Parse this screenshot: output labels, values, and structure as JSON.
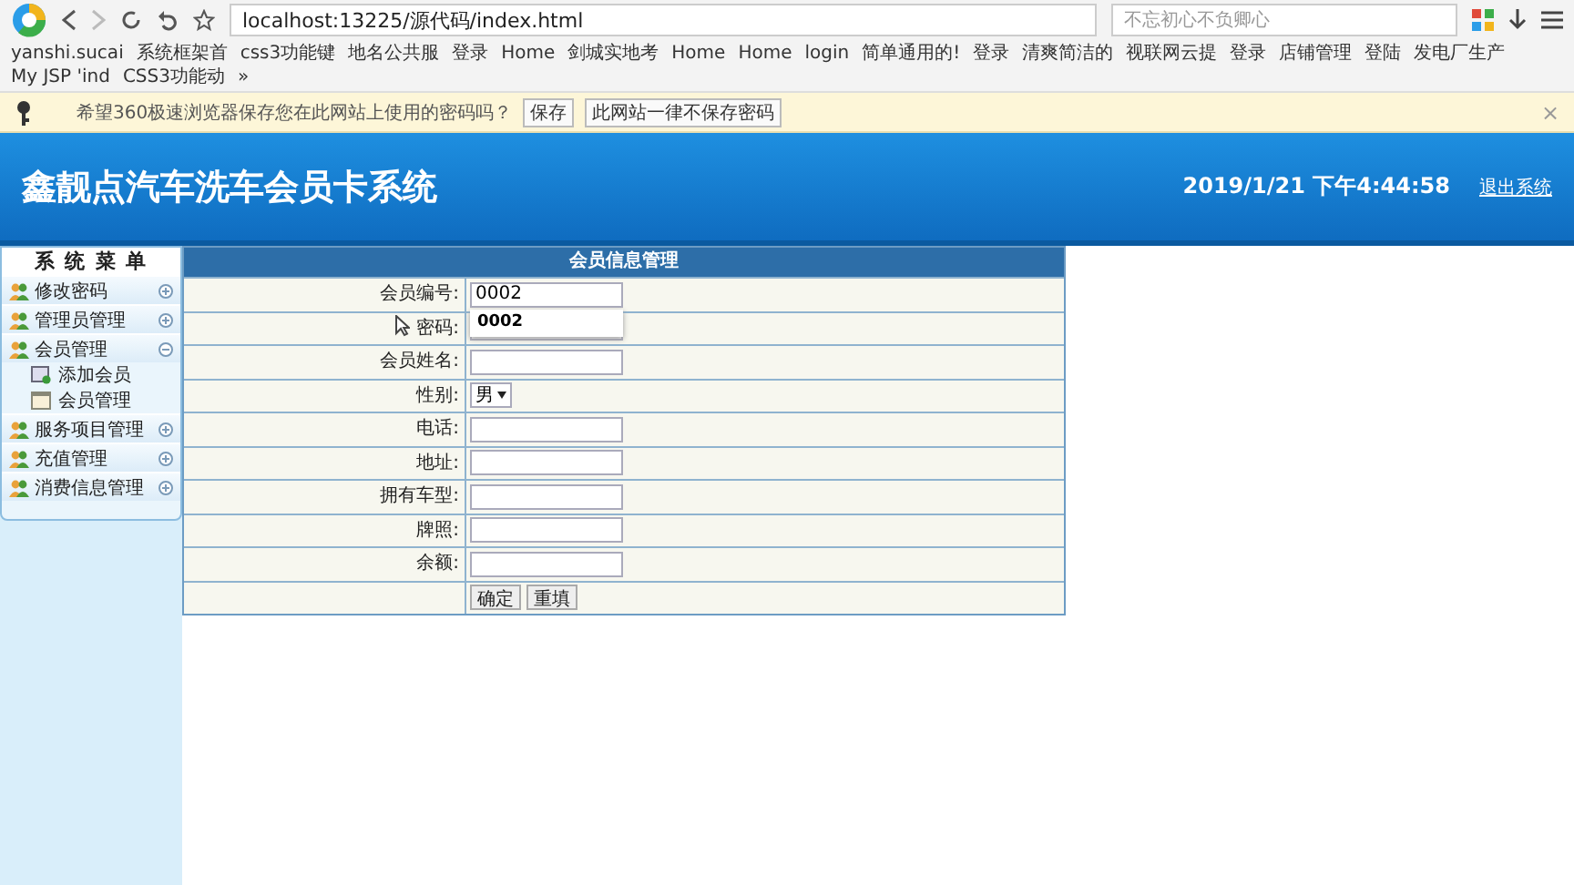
{
  "browser": {
    "address": "localhost:13225/源代码/index.html",
    "search_placeholder": "不忘初心不负卿心",
    "bookmarks": [
      "yanshi.sucai",
      "系统框架首",
      "css3功能键",
      "地名公共服",
      "登录",
      "Home",
      "剑城实地考",
      "Home",
      "Home",
      "login",
      "简单通用的!",
      "登录",
      "清爽简洁的",
      "视联网云提",
      "登录",
      "店铺管理",
      "登陆",
      "发电厂生产",
      "My JSP 'ind",
      "CSS3功能动"
    ],
    "more": "»"
  },
  "password_bar": {
    "message": "希望360极速浏览器保存您在此网站上使用的密码吗？",
    "buttons": [
      "保存",
      "此网站一律不保存密码"
    ],
    "close": "×"
  },
  "header": {
    "title": "鑫靓点汽车洗车会员卡系统",
    "datetime": "2019/1/21 下午4:44:58",
    "logout": "退出系统"
  },
  "sidebar": {
    "title": "系 统 菜 单",
    "items": [
      {
        "label": "修改密码",
        "expanded": false
      },
      {
        "label": "管理员管理",
        "expanded": false
      },
      {
        "label": "会员管理",
        "expanded": true,
        "children": [
          {
            "label": "添加会员",
            "kind": "add"
          },
          {
            "label": "会员管理",
            "kind": "list"
          }
        ]
      },
      {
        "label": "服务项目管理",
        "expanded": false
      },
      {
        "label": "充值管理",
        "expanded": false
      },
      {
        "label": "消费信息管理",
        "expanded": false
      }
    ]
  },
  "form": {
    "title": "会员信息管理",
    "fields": [
      {
        "label": "会员编号:",
        "kind": "input",
        "value": "0002",
        "suggestion": "0002"
      },
      {
        "label": "密码:",
        "kind": "input"
      },
      {
        "label": "会员姓名:",
        "kind": "input"
      },
      {
        "label": "性别:",
        "kind": "select",
        "value": "男"
      },
      {
        "label": "电话:",
        "kind": "input"
      },
      {
        "label": "地址:",
        "kind": "input"
      },
      {
        "label": "拥有车型:",
        "kind": "input"
      },
      {
        "label": "牌照:",
        "kind": "input"
      },
      {
        "label": "余额:",
        "kind": "input"
      }
    ],
    "buttons": [
      "确定",
      "重填"
    ]
  }
}
